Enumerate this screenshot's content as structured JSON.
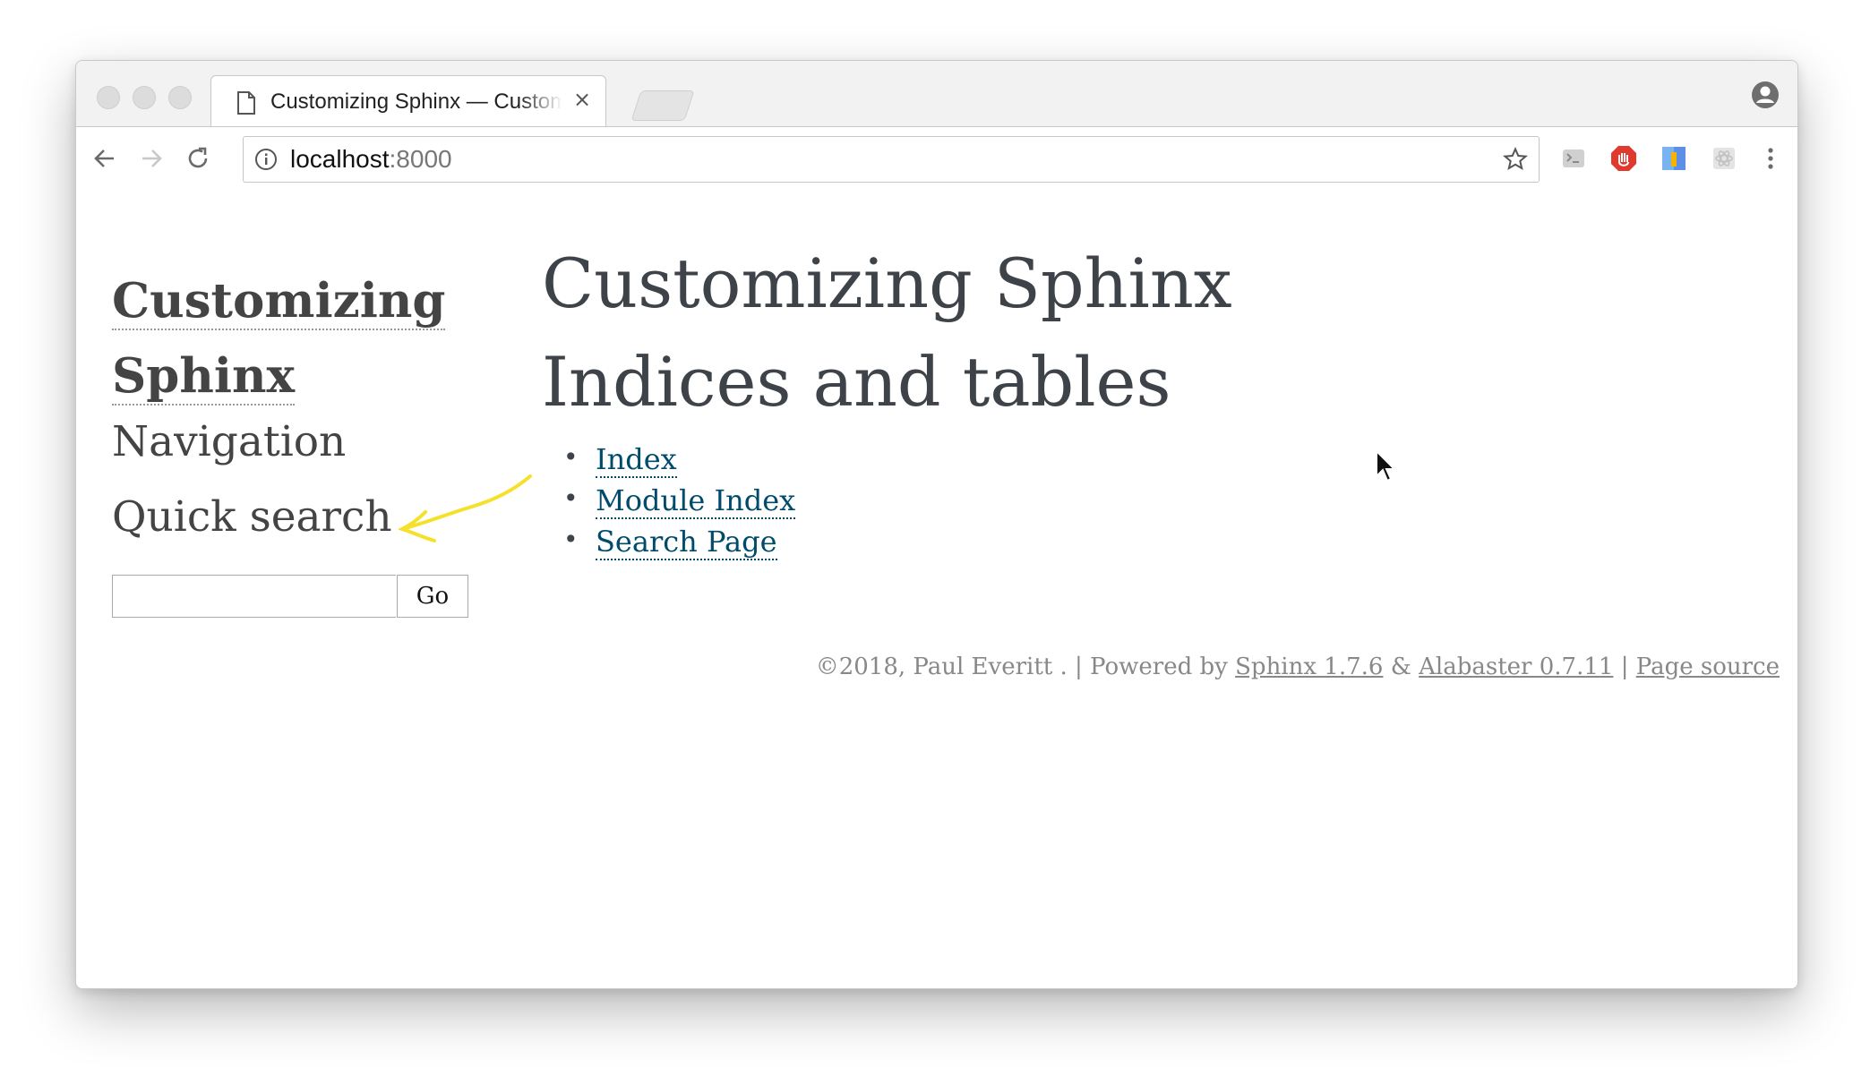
{
  "browser": {
    "tab": {
      "title": "Customizing Sphinx — Customizing Sphinx",
      "icon": "document-icon",
      "close_label": "×"
    },
    "url": {
      "host": "localhost",
      "port": ":8000"
    },
    "buttons": {
      "back": "back-arrow-icon",
      "forward": "forward-arrow-icon",
      "reload": "reload-icon",
      "bookmark": "star-icon",
      "menu": "kebab-menu-icon",
      "profile": "profile-icon"
    },
    "extensions": [
      "extension-icon-1",
      "extension-icon-2",
      "extension-icon-3",
      "extension-icon-4"
    ]
  },
  "sidebar": {
    "title_line1": "Customizing",
    "title_line2": "Sphinx",
    "navigation_heading": "Navigation",
    "quick_search_heading": "Quick search",
    "search": {
      "value": "",
      "button_label": "Go"
    }
  },
  "main": {
    "title": "Customizing Sphinx",
    "section_heading": "Indices and tables",
    "links": [
      "Index",
      "Module Index",
      "Search Page"
    ]
  },
  "footer": {
    "copyright": "©2018, Paul Everitt . | Powered by ",
    "sphinx": "Sphinx 1.7.6",
    "amp": " & ",
    "alabaster": "Alabaster 0.7.11",
    "sep": " | ",
    "page_source": "Page source"
  },
  "colors": {
    "text": "#3e4349",
    "link": "#004b6b",
    "annotation": "#f5e12a"
  }
}
